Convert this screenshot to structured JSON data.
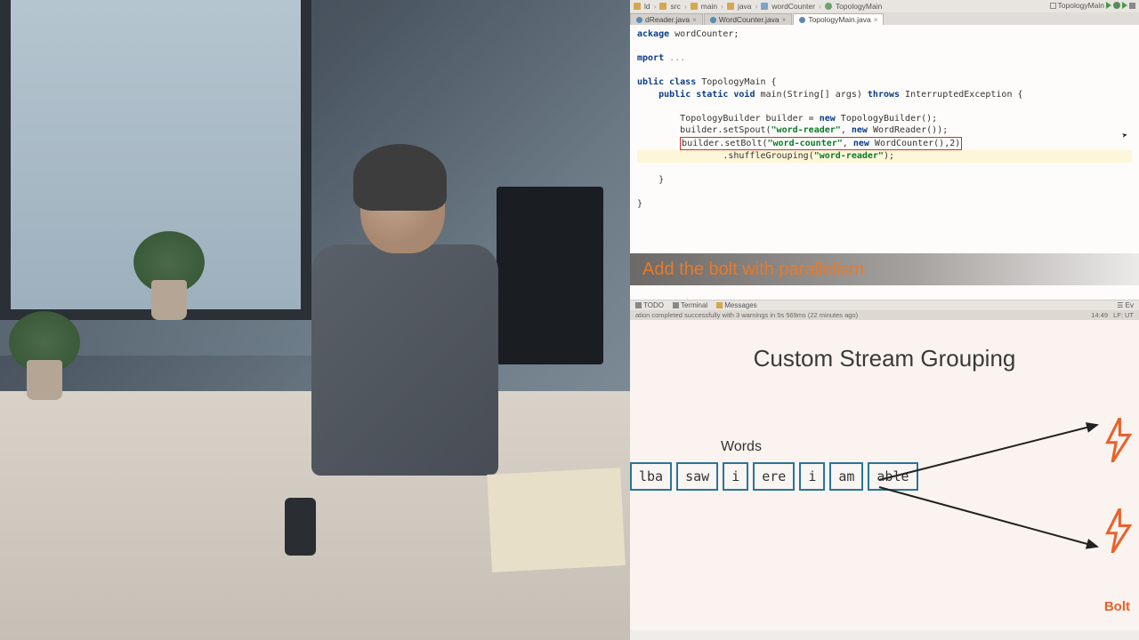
{
  "breadcrumb": {
    "items": [
      "ld",
      "src",
      "main",
      "java",
      "wordCounter",
      "TopologyMain"
    ]
  },
  "run_config": "TopologyMain",
  "tabs": [
    {
      "label": "dReader.java",
      "active": false
    },
    {
      "label": "WordCounter.java",
      "active": false
    },
    {
      "label": "TopologyMain.java",
      "active": true
    }
  ],
  "code": {
    "l1_kw": "ackage",
    "l1_rest": " wordCounter;",
    "l2_kw": "mport",
    "l2_rest": " ",
    "l2_dots": "...",
    "l3_kw1": "ublic class",
    "l3_cls": " TopologyMain {",
    "l4_ind": "    ",
    "l4_kw": "public static void",
    "l4_mid": " main(String[] args) ",
    "l4_kw2": "throws",
    "l4_tail": " InterruptedException {",
    "l5_ind": "        ",
    "l5a": "TopologyBuilder builder = ",
    "l5_kw": "new",
    "l5b": " TopologyBuilder();",
    "l6_ind": "        ",
    "l6a": "builder.setSpout(",
    "l6_str": "\"word-reader\"",
    "l6b": ", ",
    "l6_kw": "new",
    "l6c": " WordReader());",
    "l7_ind": "        ",
    "l7a": "builder.setBolt(",
    "l7_str": "\"word-counter\"",
    "l7b": ", ",
    "l7_kw": "new",
    "l7c": " WordCounter(),2)",
    "l8_ind": "                ",
    "l8a": ".shuffleGrouping(",
    "l8_str": "\"word-reader\"",
    "l8b": ");",
    "l9": "    }",
    "l10": "}"
  },
  "caption": "Add the bolt with parallelism",
  "bottom_tabs": {
    "todo": "TODO",
    "terminal": "Terminal",
    "messages": "Messages",
    "event": "Ev"
  },
  "status": {
    "msg": "ation completed successfully with 3 warnings in 5s 569ms (22 minutes ago)",
    "pos": "14:49",
    "enc": "LF:  UT"
  },
  "slide": {
    "title": "Custom Stream Grouping",
    "words_label": "Words",
    "words": [
      "lba",
      "saw",
      "i",
      "ere",
      "i",
      "am",
      "able"
    ],
    "bolt_label": "Bolt"
  }
}
